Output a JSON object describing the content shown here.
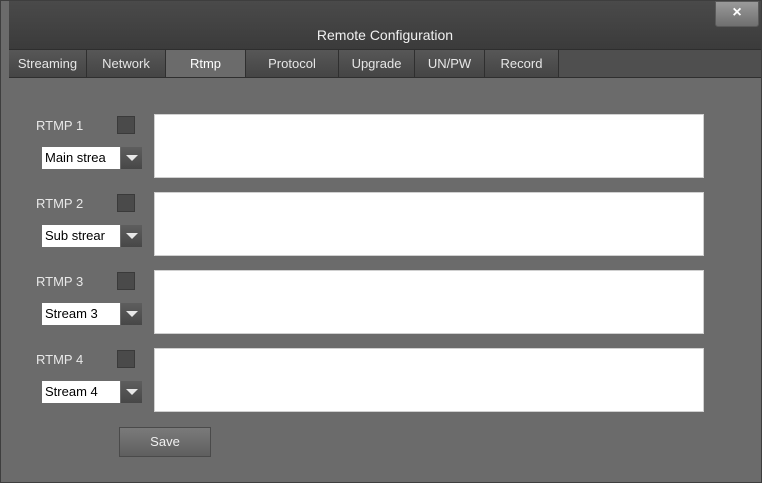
{
  "window": {
    "title": "Remote Configuration",
    "close_glyph": "×"
  },
  "tabs": [
    {
      "label": "Streaming",
      "active": false
    },
    {
      "label": "Network",
      "active": false
    },
    {
      "label": "Rtmp",
      "active": true
    },
    {
      "label": "Protocol",
      "active": false
    },
    {
      "label": "Upgrade",
      "active": false
    },
    {
      "label": "UN/PW",
      "active": false
    },
    {
      "label": "Record",
      "active": false
    }
  ],
  "rtmp": [
    {
      "label": "RTMP 1",
      "stream": "Main strea",
      "enabled": false,
      "url": ""
    },
    {
      "label": "RTMP 2",
      "stream": "Sub strear",
      "enabled": false,
      "url": ""
    },
    {
      "label": "RTMP 3",
      "stream": "Stream 3",
      "enabled": false,
      "url": ""
    },
    {
      "label": "RTMP 4",
      "stream": "Stream 4",
      "enabled": false,
      "url": ""
    }
  ],
  "actions": {
    "save_label": "Save"
  },
  "icons": {
    "close": "close-icon",
    "dropdown": "chevron-down-icon"
  },
  "colors": {
    "background": "#6b6b6b",
    "titlebar": "#3f3f3f",
    "text": "#e8e8e8",
    "input": "#ffffff"
  }
}
